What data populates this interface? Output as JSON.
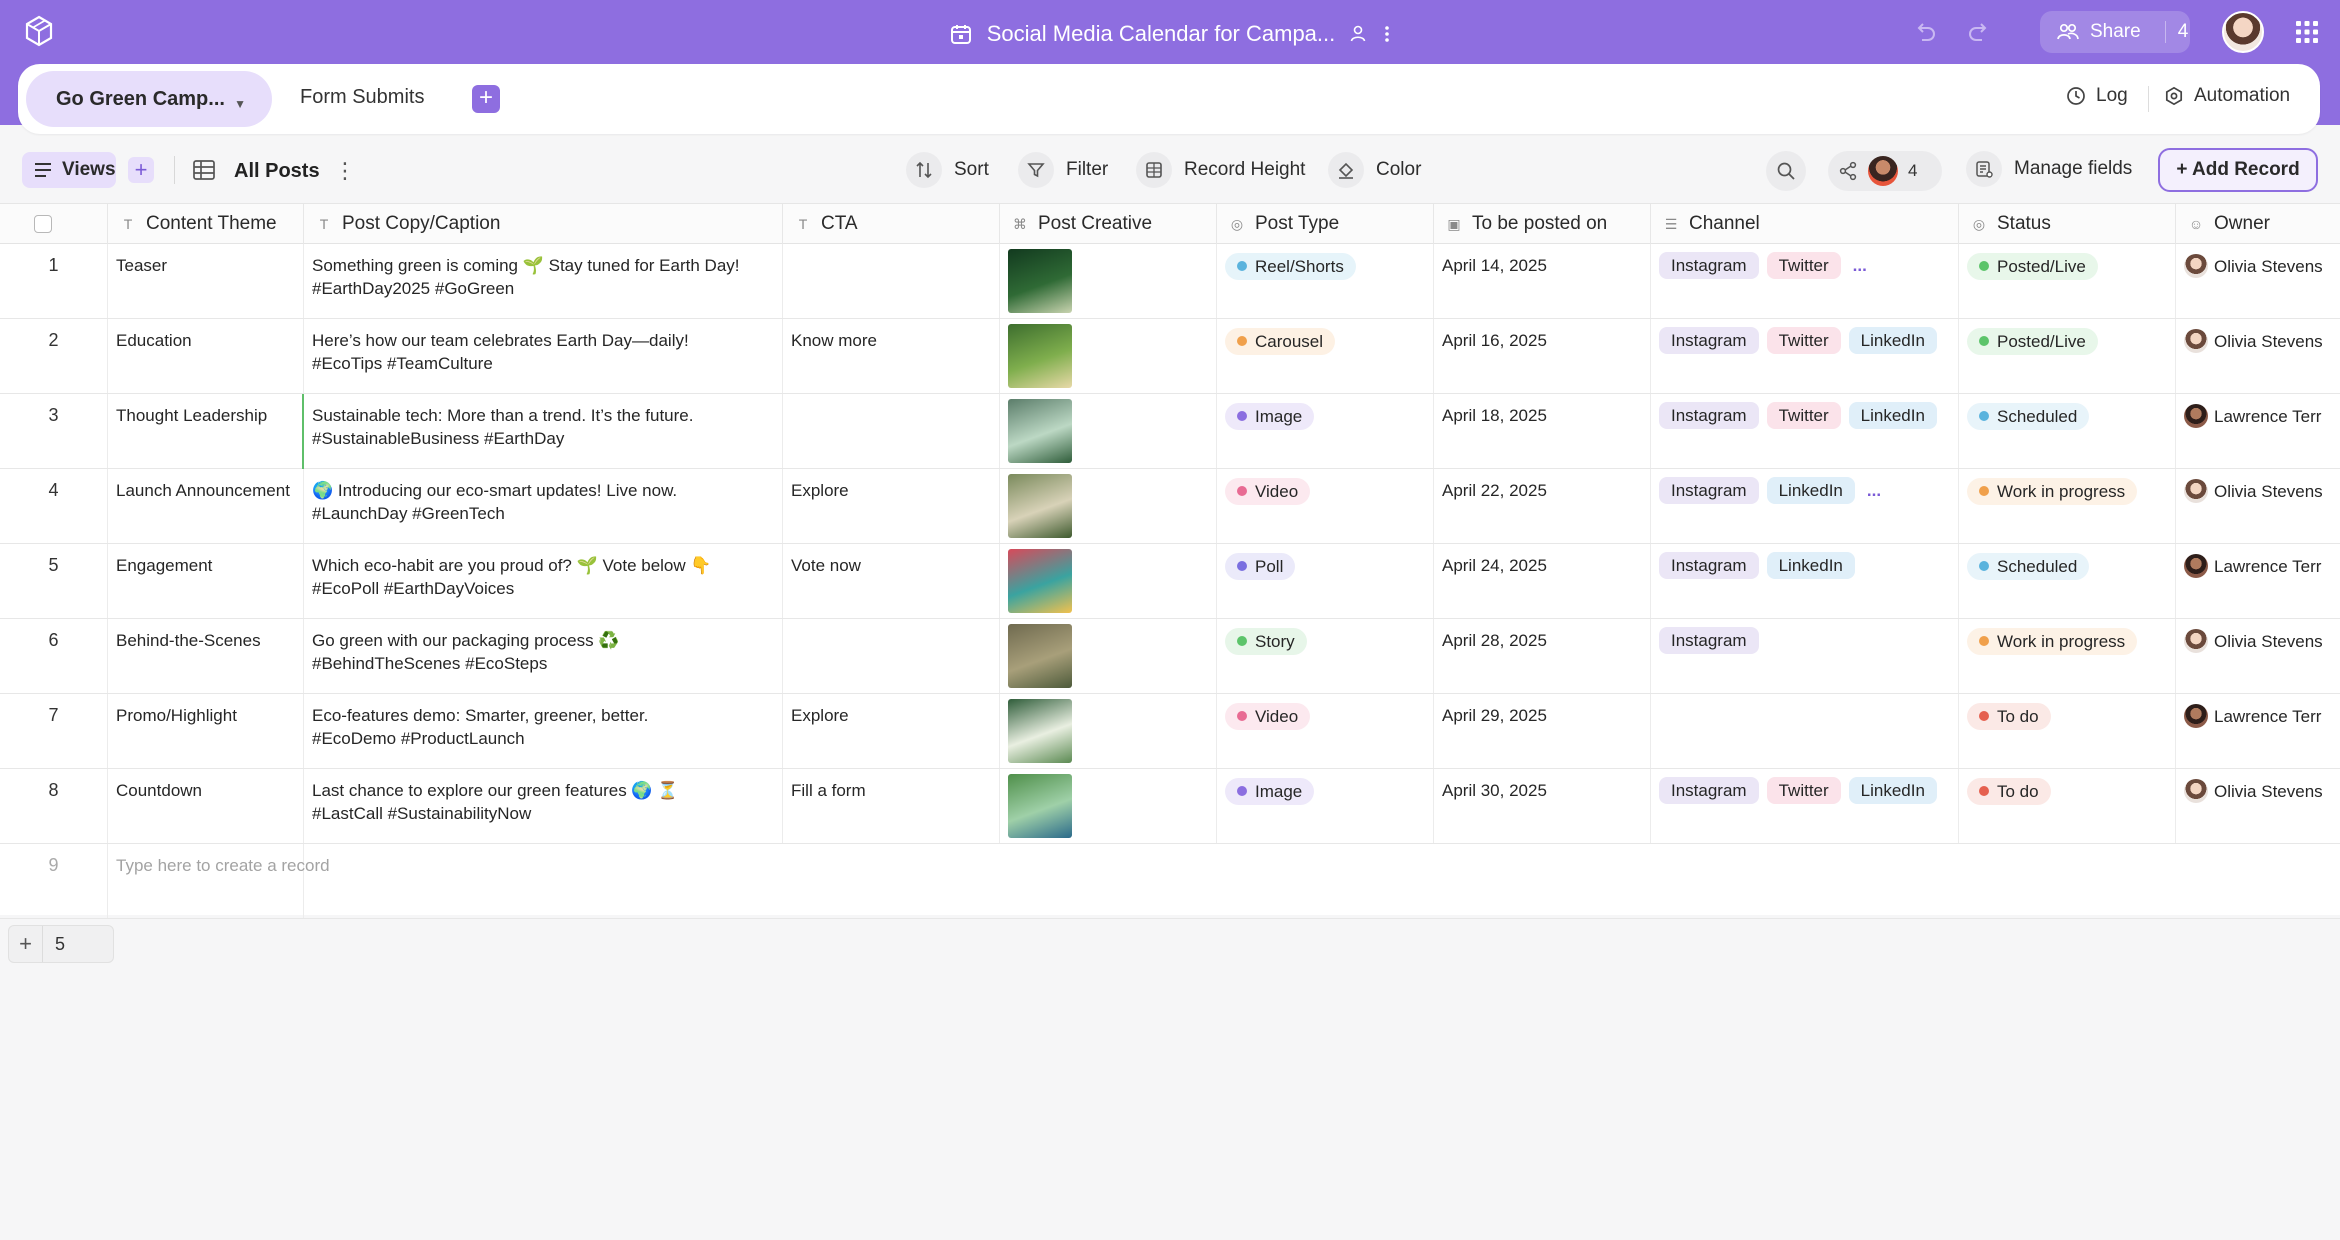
{
  "app": {
    "doc_title": "Social Media Calendar for Campa...",
    "share_label": "Share",
    "share_count": "4"
  },
  "tabs": [
    {
      "label": "Go Green Camp...",
      "active": true
    },
    {
      "label": "Form Submits",
      "active": false
    }
  ],
  "header_actions": {
    "log": "Log",
    "automation": "Automation"
  },
  "toolbar": {
    "views": "Views",
    "view_name": "All Posts",
    "sort": "Sort",
    "filter": "Filter",
    "record_height": "Record Height",
    "color": "Color",
    "collaborator_count": "4",
    "manage_fields": "Manage fields",
    "add_record": "+ Add Record"
  },
  "columns": [
    {
      "label": "Content Theme",
      "icon": "text-icon"
    },
    {
      "label": "Post Copy/Caption",
      "icon": "text-icon"
    },
    {
      "label": "CTA",
      "icon": "text-icon"
    },
    {
      "label": "Post Creative",
      "icon": "attachment-icon"
    },
    {
      "label": "Post Type",
      "icon": "single-select-icon"
    },
    {
      "label": "To be posted on",
      "icon": "date-icon"
    },
    {
      "label": "Channel",
      "icon": "multi-select-icon"
    },
    {
      "label": "Status",
      "icon": "single-select-icon"
    },
    {
      "label": "Owner",
      "icon": "user-icon"
    }
  ],
  "colors": {
    "accent": "#8e6ee0",
    "post_type": {
      "Reel/Shorts": "#5ab3dd",
      "Carousel": "#f0a04b",
      "Image": "#8b6ee0",
      "Video": "#e86b93",
      "Poll": "#7a6fe0",
      "Story": "#5cc46a"
    },
    "status": {
      "Posted/Live": "#5cc46a",
      "Scheduled": "#5ab3dd",
      "Work in progress": "#f0a04b",
      "To do": "#e5604f"
    }
  },
  "rows": [
    {
      "n": "1",
      "theme": "Teaser",
      "caption1": "Something green is coming 🌱  Stay tuned for Earth Day!",
      "caption2": "#EarthDay2025 #GoGreen",
      "cta": "",
      "type": "Reel/Shorts",
      "date": "April 14, 2025",
      "channels": [
        "Instagram",
        "Twitter"
      ],
      "more": "...",
      "status": "Posted/Live",
      "owner": "Olivia Stevens"
    },
    {
      "n": "2",
      "theme": "Education",
      "caption1": "Here’s how our team celebrates Earth Day—daily!",
      "caption2": "#EcoTips #TeamCulture",
      "cta": "Know more",
      "type": "Carousel",
      "date": "April 16, 2025",
      "channels": [
        "Instagram",
        "Twitter",
        "LinkedIn"
      ],
      "more": "",
      "status": "Posted/Live",
      "owner": "Olivia Stevens"
    },
    {
      "n": "3",
      "theme": "Thought Leadership",
      "caption1": "Sustainable tech: More than a trend. It’s the future.",
      "caption2": "#SustainableBusiness #EarthDay",
      "cta": "",
      "type": "Image",
      "date": "April 18, 2025",
      "channels": [
        "Instagram",
        "Twitter",
        "LinkedIn"
      ],
      "more": "",
      "status": "Scheduled",
      "owner": "Lawrence Terr"
    },
    {
      "n": "4",
      "theme": "Launch Announcement",
      "caption1": "🌍  Introducing our eco-smart updates! Live now.",
      "caption2": "#LaunchDay #GreenTech",
      "cta": "Explore",
      "type": "Video",
      "date": "April 22, 2025",
      "channels": [
        "Instagram",
        "LinkedIn"
      ],
      "more": "...",
      "status": "Work in progress",
      "owner": "Olivia Stevens"
    },
    {
      "n": "5",
      "theme": "Engagement",
      "caption1": "Which eco-habit are you proud of? 🌱  Vote below 👇",
      "caption2": "#EcoPoll #EarthDayVoices",
      "cta": "Vote now",
      "type": "Poll",
      "date": "April 24, 2025",
      "channels": [
        "Instagram",
        "LinkedIn"
      ],
      "more": "",
      "status": "Scheduled",
      "owner": "Lawrence Terr"
    },
    {
      "n": "6",
      "theme": "Behind-the-Scenes",
      "caption1": "Go green with our packaging process ♻️",
      "caption2": "#BehindTheScenes #EcoSteps",
      "cta": "",
      "type": "Story",
      "date": "April 28, 2025",
      "channels": [
        "Instagram"
      ],
      "more": "",
      "status": "Work in progress",
      "owner": "Olivia Stevens"
    },
    {
      "n": "7",
      "theme": "Promo/Highlight",
      "caption1": "Eco-features demo: Smarter, greener, better.",
      "caption2": "#EcoDemo #ProductLaunch",
      "cta": "Explore",
      "type": "Video",
      "date": "April 29, 2025",
      "channels": [],
      "more": "",
      "status": "To do",
      "owner": "Lawrence Terr"
    },
    {
      "n": "8",
      "theme": "Countdown",
      "caption1": "Last chance to explore our green features 🌍 ⏳",
      "caption2": "#LastCall #SustainabilityNow",
      "cta": "Fill a form",
      "type": "Image",
      "date": "April 30, 2025",
      "channels": [
        "Instagram",
        "Twitter",
        "LinkedIn"
      ],
      "more": "",
      "status": "To do",
      "owner": "Olivia Stevens"
    }
  ],
  "new_row": {
    "n": "9",
    "placeholder": "Type here to create a record"
  },
  "footer": {
    "add_count": "5"
  }
}
